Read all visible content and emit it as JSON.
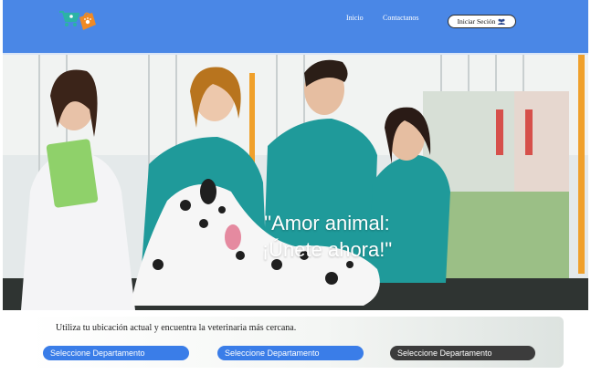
{
  "header": {
    "logo_icon": "pet-shop-logo-icon",
    "nav": [
      {
        "label": "Inicio"
      },
      {
        "label": "Contactanos"
      }
    ],
    "login_label": "Iniciar Seción",
    "login_icon": "users-icon",
    "accent_color": "#4a87e6"
  },
  "hero": {
    "headline_line1": "\"Amor animal:",
    "headline_line2": "¡Únete ahora!\""
  },
  "search": {
    "caption": "Utiliza tu ubicación actual y encuentra la veterinaria más cercana.",
    "selects": [
      {
        "label": "Seleccione Departamento",
        "color": "#3a7de8"
      },
      {
        "label": "Seleccione Departamento",
        "color": "#3a7de8"
      },
      {
        "label": "Seleccione Departamento",
        "color": "#3c3c3c"
      }
    ]
  }
}
